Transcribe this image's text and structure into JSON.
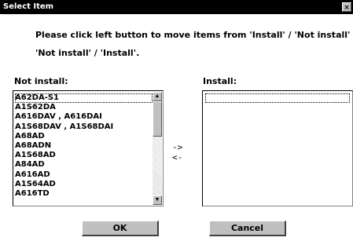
{
  "window": {
    "title": "Select Item",
    "close_glyph": "×"
  },
  "instructions": {
    "line1": "Please click left button to move items from 'Install' / 'Not install' to",
    "line2": "'Not install' / 'Install'."
  },
  "not_install": {
    "label": "Not install:",
    "items": [
      "A62DA-S1",
      "A1S62DA",
      "A616DAV , A616DAI",
      "A1S68DAV , A1S68DAI",
      "A68AD",
      "A68ADN",
      "A1S68AD",
      "A84AD",
      "A616AD",
      "A1S64AD",
      "A616TD"
    ],
    "scroll": {
      "up_icon": "▲",
      "down_icon": "▼"
    }
  },
  "install": {
    "label": "Install:",
    "items": []
  },
  "arrows": {
    "move_right": "->",
    "move_left": "<-"
  },
  "buttons": {
    "ok": "OK",
    "cancel": "Cancel"
  }
}
